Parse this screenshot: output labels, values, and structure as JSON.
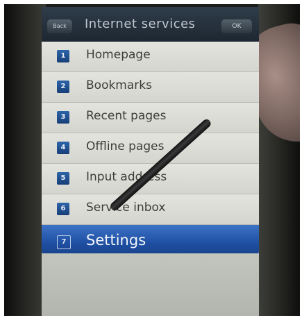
{
  "header": {
    "back_label": "Back",
    "title": "Internet services",
    "ok_label": "OK"
  },
  "menu": {
    "items": [
      {
        "number": "1",
        "label": "Homepage"
      },
      {
        "number": "2",
        "label": "Bookmarks"
      },
      {
        "number": "3",
        "label": "Recent pages"
      },
      {
        "number": "4",
        "label": "Offline pages"
      },
      {
        "number": "5",
        "label": "Input address"
      },
      {
        "number": "6",
        "label": "Service inbox"
      },
      {
        "number": "7",
        "label": "Settings"
      }
    ],
    "selected_index": 6
  },
  "colors": {
    "title_bar": "#1d2731",
    "menu_item": "#d9dad2",
    "selected": "#1f4fa2"
  }
}
